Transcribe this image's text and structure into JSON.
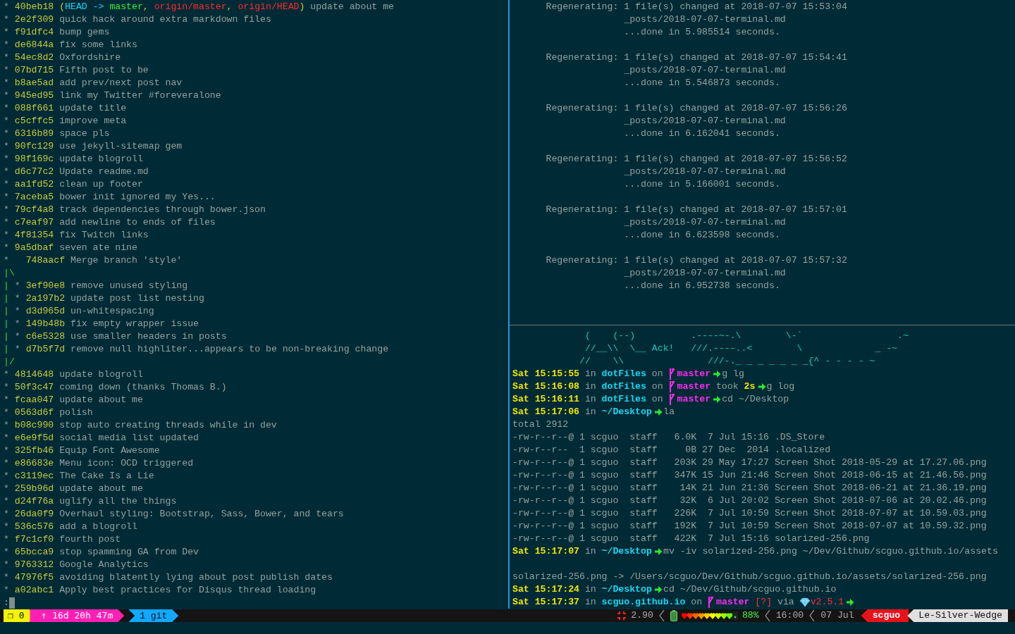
{
  "left_pane": {
    "log": [
      {
        "kind": "commit",
        "graph": "*",
        "hash": "40beb18",
        "refs": [
          {
            "text": "(",
            "kind": "punct"
          },
          {
            "text": "HEAD -> ",
            "kind": "head"
          },
          {
            "text": "master",
            "kind": "branch"
          },
          {
            "text": ", ",
            "kind": "punct"
          },
          {
            "text": "origin/master",
            "kind": "remote"
          },
          {
            "text": ", ",
            "kind": "punct"
          },
          {
            "text": "origin/HEAD",
            "kind": "remote"
          },
          {
            "text": ")",
            "kind": "punct"
          }
        ],
        "message": "update about me"
      },
      {
        "kind": "commit",
        "graph": "*",
        "hash": "2e2f309",
        "message": "quick hack around extra markdown files"
      },
      {
        "kind": "commit",
        "graph": "*",
        "hash": "f91dfc4",
        "message": "bump gems"
      },
      {
        "kind": "commit",
        "graph": "*",
        "hash": "de6844a",
        "message": "fix some links"
      },
      {
        "kind": "commit",
        "graph": "*",
        "hash": "54ec8d2",
        "message": "Oxfordshire"
      },
      {
        "kind": "commit",
        "graph": "*",
        "hash": "07bd715",
        "message": "Fifth post to be"
      },
      {
        "kind": "commit",
        "graph": "*",
        "hash": "b8ae5ad",
        "message": "add prev/next post nav"
      },
      {
        "kind": "commit",
        "graph": "*",
        "hash": "945ed95",
        "message": "link my Twitter #foreveralone"
      },
      {
        "kind": "commit",
        "graph": "*",
        "hash": "088f661",
        "message": "update title"
      },
      {
        "kind": "commit",
        "graph": "*",
        "hash": "c5cffc5",
        "message": "improve meta"
      },
      {
        "kind": "commit",
        "graph": "*",
        "hash": "6316b89",
        "message": "space pls"
      },
      {
        "kind": "commit",
        "graph": "*",
        "hash": "90fc129",
        "message": "use jekyll-sitemap gem"
      },
      {
        "kind": "commit",
        "graph": "*",
        "hash": "98f169c",
        "message": "update blogroll"
      },
      {
        "kind": "commit",
        "graph": "*",
        "hash": "d6c77c2",
        "message": "Update readme.md"
      },
      {
        "kind": "commit",
        "graph": "*",
        "hash": "aa1fd52",
        "message": "clean up footer"
      },
      {
        "kind": "commit",
        "graph": "*",
        "hash": "7aceba5",
        "message": "bower init ignored my Yes..."
      },
      {
        "kind": "commit",
        "graph": "*",
        "hash": "79cf4a8",
        "message": "track dependencies through bower.json"
      },
      {
        "kind": "commit",
        "graph": "*",
        "hash": "c7eaf97",
        "message": "add newline to ends of files"
      },
      {
        "kind": "commit",
        "graph": "*",
        "hash": "4f81354",
        "message": "fix Twitch links"
      },
      {
        "kind": "commit",
        "graph": "*",
        "hash": "9a5dbaf",
        "message": "seven ate nine"
      },
      {
        "kind": "merge",
        "graph": "*",
        "hash": "748aacf",
        "message": "Merge branch 'style'"
      },
      {
        "kind": "edge",
        "graph": "|\\"
      },
      {
        "kind": "commit",
        "graph": "| *",
        "hash": "3ef90e8",
        "message": "remove unused styling"
      },
      {
        "kind": "commit",
        "graph": "| *",
        "hash": "2a197b2",
        "message": "update post list nesting"
      },
      {
        "kind": "commit",
        "graph": "| *",
        "hash": "d3d965d",
        "message": "un-whitespacing"
      },
      {
        "kind": "commit",
        "graph": "| *",
        "hash": "149b48b",
        "message": "fix empty wrapper issue"
      },
      {
        "kind": "commit",
        "graph": "| *",
        "hash": "c6e5328",
        "message": "use smaller headers in posts"
      },
      {
        "kind": "commit",
        "graph": "| *",
        "hash": "d7b5f7d",
        "message": "remove null highliter...appears to be non-breaking change"
      },
      {
        "kind": "edge",
        "graph": "|/"
      },
      {
        "kind": "commit",
        "graph": "*",
        "hash": "4814648",
        "message": "update blogroll"
      },
      {
        "kind": "commit",
        "graph": "*",
        "hash": "50f3c47",
        "message": "coming down (thanks Thomas B.)"
      },
      {
        "kind": "commit",
        "graph": "*",
        "hash": "fcaa047",
        "message": "update about me"
      },
      {
        "kind": "commit",
        "graph": "*",
        "hash": "0563d6f",
        "message": "polish"
      },
      {
        "kind": "commit",
        "graph": "*",
        "hash": "b08c990",
        "message": "stop auto creating threads while in dev"
      },
      {
        "kind": "commit",
        "graph": "*",
        "hash": "e6e9f5d",
        "message": "social media list updated"
      },
      {
        "kind": "commit",
        "graph": "*",
        "hash": "325fb46",
        "message": "Equip Font Awesome"
      },
      {
        "kind": "commit",
        "graph": "*",
        "hash": "e86683e",
        "message": "Menu icon: OCD triggered"
      },
      {
        "kind": "commit",
        "graph": "*",
        "hash": "c3119ec",
        "message": "The Cake Is a Lie"
      },
      {
        "kind": "commit",
        "graph": "*",
        "hash": "259b96d",
        "message": "update about me"
      },
      {
        "kind": "commit",
        "graph": "*",
        "hash": "d24f76a",
        "message": "uglify all the things"
      },
      {
        "kind": "commit",
        "graph": "*",
        "hash": "26da0f9",
        "message": "Overhaul styling: Bootstrap, Sass, Bower, and tears"
      },
      {
        "kind": "commit",
        "graph": "*",
        "hash": "536c576",
        "message": "add a blogroll"
      },
      {
        "kind": "commit",
        "graph": "*",
        "hash": "f7c1cf0",
        "message": "fourth post"
      },
      {
        "kind": "commit",
        "graph": "*",
        "hash": "65bcca9",
        "message": "stop spamming GA from Dev"
      },
      {
        "kind": "commit",
        "graph": "*",
        "hash": "9763312",
        "message": "Google Analytics"
      },
      {
        "kind": "commit",
        "graph": "*",
        "hash": "47976f5",
        "message": "avoiding blatently lying about post publish dates"
      },
      {
        "kind": "commit",
        "graph": "*",
        "hash": "a02abc1",
        "message": "Apply best practices for Disqus thread loading"
      }
    ],
    "pager_prompt": ":"
  },
  "jekyll_log": [
    {
      "label": "Regenerating:",
      "lines": [
        "1 file(s) changed at 2018-07-07 15:53:04",
        "_posts/2018-07-07-terminal.md",
        "...done in 5.985514 seconds."
      ]
    },
    {
      "label": "Regenerating:",
      "lines": [
        "1 file(s) changed at 2018-07-07 15:54:41",
        "_posts/2018-07-07-terminal.md",
        "...done in 5.546873 seconds."
      ]
    },
    {
      "label": "Regenerating:",
      "lines": [
        "1 file(s) changed at 2018-07-07 15:56:26",
        "_posts/2018-07-07-terminal.md",
        "...done in 6.162041 seconds."
      ]
    },
    {
      "label": "Regenerating:",
      "lines": [
        "1 file(s) changed at 2018-07-07 15:56:52",
        "_posts/2018-07-07-terminal.md",
        "...done in 5.166001 seconds."
      ]
    },
    {
      "label": "Regenerating:",
      "lines": [
        "1 file(s) changed at 2018-07-07 15:57:01",
        "_posts/2018-07-07-terminal.md",
        "...done in 6.623598 seconds."
      ]
    },
    {
      "label": "Regenerating:",
      "lines": [
        "1 file(s) changed at 2018-07-07 15:57:32",
        "_posts/2018-07-07-terminal.md",
        "...done in 6.952738 seconds."
      ]
    }
  ],
  "shell": [
    {
      "kind": "art",
      "text": "             (    (--)          .----~-.\\        \\-`                 .~"
    },
    {
      "kind": "art",
      "text": "             //__\\\\  \\__ Ack!   ///.----..<        \\             _ -~"
    },
    {
      "kind": "art",
      "text": "            //    \\\\               ///-._ _ _ _ _ _ _{^ - - - - ~"
    },
    {
      "kind": "prompt",
      "segments": [
        {
          "kind": "time",
          "text": "Sat 15:15:55"
        },
        {
          "kind": "word",
          "text": "in"
        },
        {
          "kind": "dir",
          "text": "dotFiles"
        },
        {
          "kind": "word",
          "text": "on"
        },
        {
          "kind": "branch",
          "text": "master"
        },
        {
          "kind": "arrow"
        },
        {
          "kind": "command",
          "text": "g lg"
        }
      ]
    },
    {
      "kind": "prompt",
      "segments": [
        {
          "kind": "time",
          "text": "Sat 15:16:08"
        },
        {
          "kind": "word",
          "text": "in"
        },
        {
          "kind": "dir",
          "text": "dotFiles"
        },
        {
          "kind": "word",
          "text": "on"
        },
        {
          "kind": "branch",
          "text": "master"
        },
        {
          "kind": "word",
          "text": "took"
        },
        {
          "kind": "duration",
          "text": "2s"
        },
        {
          "kind": "arrow"
        },
        {
          "kind": "command",
          "text": "g log"
        }
      ]
    },
    {
      "kind": "prompt",
      "segments": [
        {
          "kind": "time",
          "text": "Sat 15:16:11"
        },
        {
          "kind": "word",
          "text": "in"
        },
        {
          "kind": "dir",
          "text": "dotFiles"
        },
        {
          "kind": "word",
          "text": "on"
        },
        {
          "kind": "branch",
          "text": "master"
        },
        {
          "kind": "arrow"
        },
        {
          "kind": "command",
          "text": "cd ~/Desktop"
        }
      ]
    },
    {
      "kind": "prompt",
      "segments": [
        {
          "kind": "time",
          "text": "Sat 15:17:06"
        },
        {
          "kind": "word",
          "text": "in"
        },
        {
          "kind": "dir",
          "text": "~/Desktop"
        },
        {
          "kind": "arrow"
        },
        {
          "kind": "command",
          "text": "la"
        }
      ]
    },
    {
      "kind": "output",
      "text": "total 2912"
    },
    {
      "kind": "output",
      "text": "-rw-r--r--@ 1 scguo  staff   6.0K  7 Jul 15:16 .DS_Store"
    },
    {
      "kind": "output",
      "text": "-rw-r--r--  1 scguo  staff     0B 27 Dec  2014 .localized"
    },
    {
      "kind": "output",
      "text": "-rw-r--r--@ 1 scguo  staff   203K 29 May 17:27 Screen Shot 2018-05-29 at 17.27.06.png"
    },
    {
      "kind": "output",
      "text": "-rw-r--r--@ 1 scguo  staff   347K 15 Jun 21:46 Screen Shot 2018-06-15 at 21.46.56.png"
    },
    {
      "kind": "output",
      "text": "-rw-r--r--@ 1 scguo  staff    14K 21 Jun 21:36 Screen Shot 2018-06-21 at 21.36.19.png"
    },
    {
      "kind": "output",
      "text": "-rw-r--r--@ 1 scguo  staff    32K  6 Jul 20:02 Screen Shot 2018-07-06 at 20.02.46.png"
    },
    {
      "kind": "output",
      "text": "-rw-r--r--@ 1 scguo  staff   226K  7 Jul 10:59 Screen Shot 2018-07-07 at 10.59.03.png"
    },
    {
      "kind": "output",
      "text": "-rw-r--r--@ 1 scguo  staff   192K  7 Jul 10:59 Screen Shot 2018-07-07 at 10.59.32.png"
    },
    {
      "kind": "output",
      "text": "-rw-r--r--@ 1 scguo  staff   422K  7 Jul 15:16 solarized-256.png"
    },
    {
      "kind": "prompt",
      "segments": [
        {
          "kind": "time",
          "text": "Sat 15:17:07"
        },
        {
          "kind": "word",
          "text": "in"
        },
        {
          "kind": "dir",
          "text": "~/Desktop"
        },
        {
          "kind": "arrow"
        },
        {
          "kind": "command",
          "text": "mv -iv solarized-256.png ~/Dev/Github/scguo.github.io/assets"
        }
      ]
    },
    {
      "kind": "blank"
    },
    {
      "kind": "output",
      "text": "solarized-256.png -> /Users/scguo/Dev/Github/scguo.github.io/assets/solarized-256.png"
    },
    {
      "kind": "prompt",
      "segments": [
        {
          "kind": "time",
          "text": "Sat 15:17:24"
        },
        {
          "kind": "word",
          "text": "in"
        },
        {
          "kind": "dir",
          "text": "~/Desktop"
        },
        {
          "kind": "arrow"
        },
        {
          "kind": "command",
          "text": "cd ~/Dev/Github/scguo.github.io"
        }
      ]
    },
    {
      "kind": "prompt",
      "segments": [
        {
          "kind": "time",
          "text": "Sat 15:17:37"
        },
        {
          "kind": "word",
          "text": "in"
        },
        {
          "kind": "dir",
          "text": "scguo.github.io"
        },
        {
          "kind": "word",
          "text": "on"
        },
        {
          "kind": "branch",
          "text": "master"
        },
        {
          "kind": "status",
          "text": "[?]"
        },
        {
          "kind": "word",
          "text": "via"
        },
        {
          "kind": "ruby",
          "text": "v2.5.1"
        },
        {
          "kind": "arrow"
        }
      ]
    }
  ],
  "status_bar": {
    "left": [
      {
        "kind": "session",
        "text": "❐ 0"
      },
      {
        "kind": "uptime",
        "text": "↑ 16d 20h 47m"
      }
    ],
    "windows": [
      {
        "text": "1 git",
        "selected": true
      }
    ],
    "load": "2.90",
    "battery": {
      "level": 0.9,
      "percent": "88%"
    },
    "time": "16:00",
    "date": "07 Jul",
    "user": "scguo",
    "host": "Le-Silver-Wedge"
  }
}
